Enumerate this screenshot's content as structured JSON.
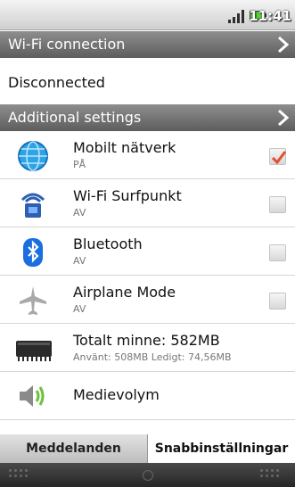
{
  "status_bar": {
    "time": "11:41"
  },
  "wifi_section": {
    "header": "Wi-Fi connection",
    "status": "Disconnected"
  },
  "additional_section": {
    "header": "Additional settings"
  },
  "settings": [
    {
      "title": "Mobilt nätverk",
      "subtitle": "PÅ",
      "checked": true
    },
    {
      "title": "Wi-Fi Surfpunkt",
      "subtitle": "AV",
      "checked": false
    },
    {
      "title": "Bluetooth",
      "subtitle": "AV",
      "checked": false
    },
    {
      "title": "Airplane Mode",
      "subtitle": "AV",
      "checked": false
    },
    {
      "title": "Totalt minne: 582MB",
      "subtitle": "Använt: 508MB  Ledigt: 74,56MB"
    },
    {
      "title": "Medievolym"
    }
  ],
  "tabs": [
    {
      "label": "Meddelanden",
      "active": false
    },
    {
      "label": "Snabbinställningar",
      "active": true
    }
  ],
  "colors": {
    "accent_check": "#e0502e",
    "header_bg": "#6f6f6f"
  },
  "icons": [
    "globe-icon",
    "wifi-hotspot-icon",
    "bluetooth-icon",
    "airplane-icon",
    "memory-chip-icon",
    "speaker-icon"
  ]
}
